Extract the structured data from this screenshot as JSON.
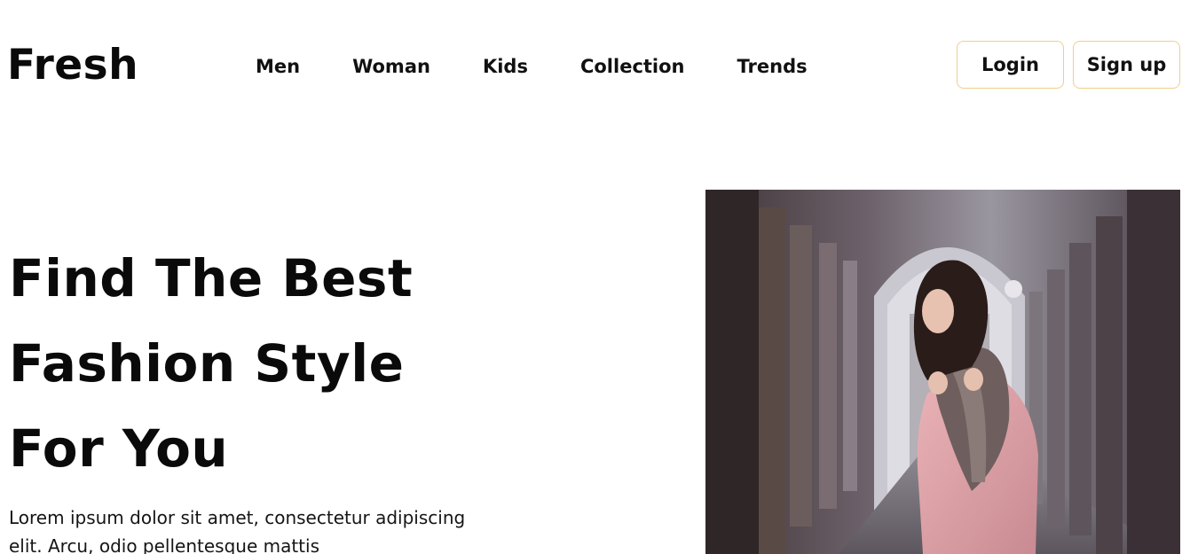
{
  "brand": {
    "logo": "Fresh"
  },
  "nav": {
    "items": [
      {
        "label": "Men"
      },
      {
        "label": "Woman"
      },
      {
        "label": "Kids"
      },
      {
        "label": "Collection"
      },
      {
        "label": "Trends"
      }
    ]
  },
  "auth": {
    "login_label": "Login",
    "signup_label": "Sign up"
  },
  "hero": {
    "title_lines": [
      "Find The Best",
      "Fashion Style",
      "For You"
    ],
    "body": "Lorem ipsum dolor sit amet, consectetur adipiscing elit. Arcu, odio pellentesque mattis"
  },
  "colors": {
    "button_border": "#f2cd8d",
    "text": "#0a0a0a",
    "background": "#ffffff"
  }
}
